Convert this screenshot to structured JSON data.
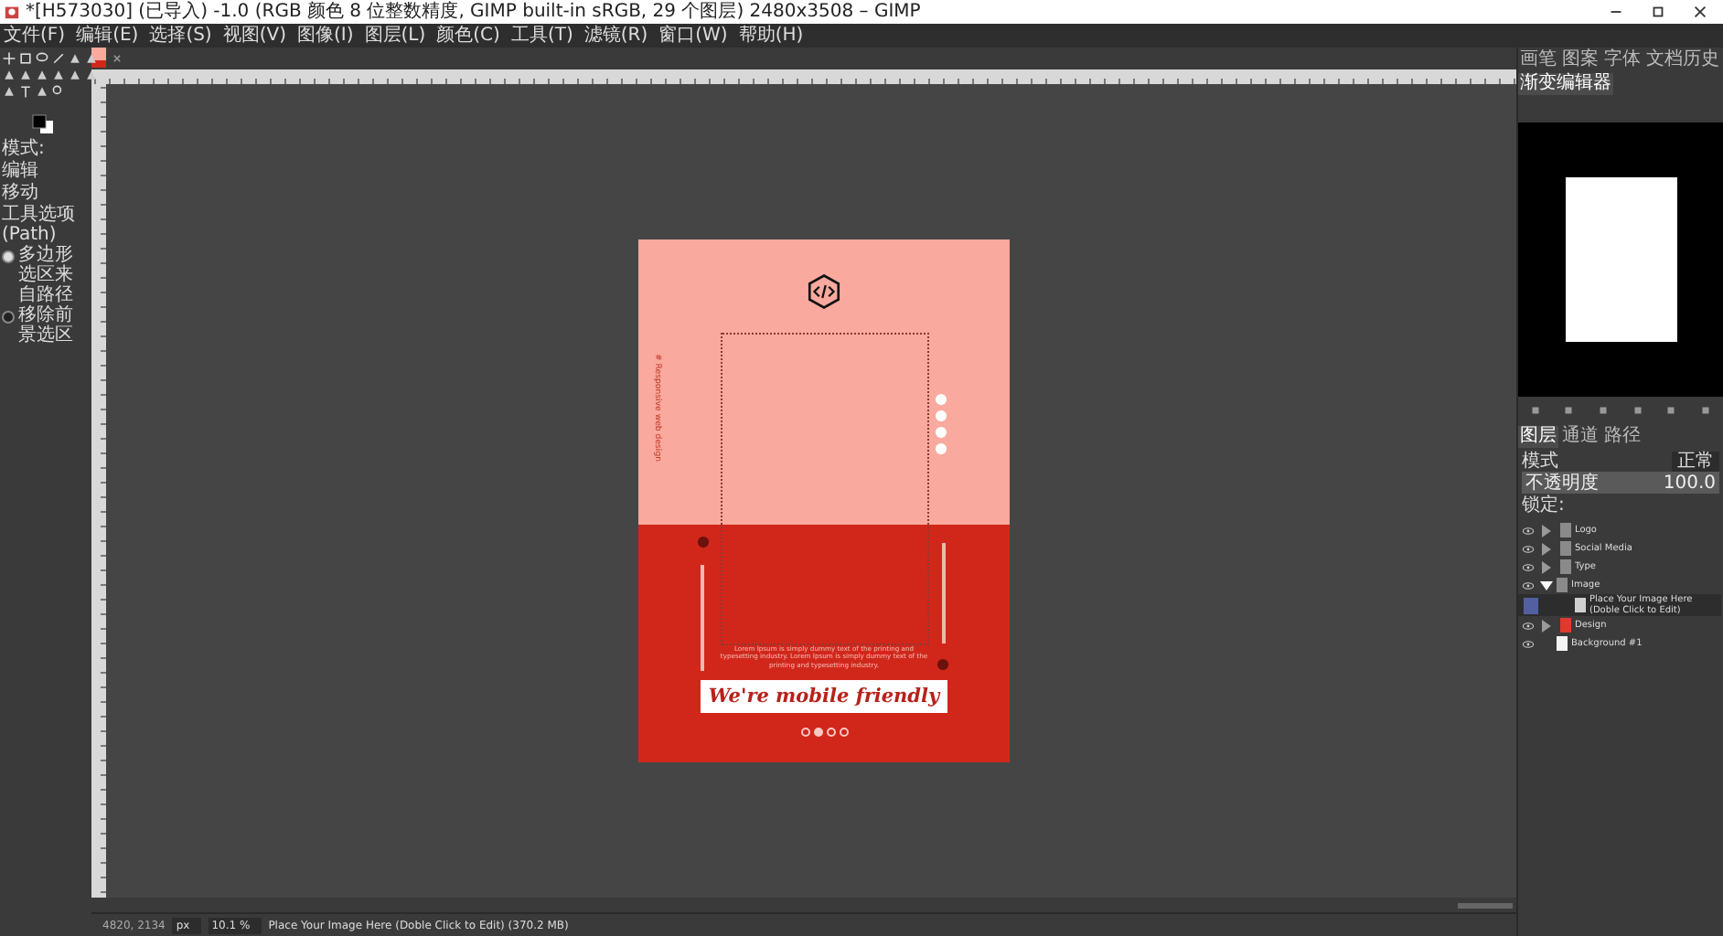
{
  "window": {
    "title": "*[H573030] (已导入) -1.0 (RGB 颜色 8 位整数精度, GIMP built-in sRGB, 29 个图层) 2480x3508 – GIMP"
  },
  "menu": [
    "文件(F)",
    "编辑(E)",
    "选择(S)",
    "视图(V)",
    "图像(I)",
    "图层(L)",
    "颜色(C)",
    "工具(T)",
    "滤镜(R)",
    "窗口(W)",
    "帮助(H)"
  ],
  "tool_options": {
    "mode_label": "模式:",
    "edit_label": "编辑",
    "move_label": "移动",
    "title": "工具选项 (Path)",
    "options": [
      {
        "label": "多边形选区来自路径",
        "checked": true
      },
      {
        "label": "移除前景选区",
        "checked": false
      }
    ]
  },
  "dock_tabs": [
    {
      "label": "画笔",
      "selected": false
    },
    {
      "label": "图案",
      "selected": false
    },
    {
      "label": "字体",
      "selected": false
    },
    {
      "label": "文档历史",
      "selected": false
    },
    {
      "label": "渐变编辑器",
      "selected": true
    }
  ],
  "layers_panel": {
    "tabs": [
      {
        "label": "图层",
        "selected": true
      },
      {
        "label": "通道",
        "selected": false
      },
      {
        "label": "路径",
        "selected": false
      }
    ],
    "mode_label": "模式",
    "mode_value": "正常",
    "opacity": {
      "label": "不透明度",
      "value": "100.0",
      "level": 1
    },
    "lock_label": "锁定:",
    "layers": [
      {
        "name": "Logo",
        "kind": "group",
        "visible": true,
        "expanded": false,
        "selected": false,
        "color": "#8a8a8a"
      },
      {
        "name": "Social Media",
        "kind": "group",
        "visible": true,
        "expanded": false,
        "selected": false,
        "color": "#8a8a8a"
      },
      {
        "name": "Type",
        "kind": "group",
        "visible": true,
        "expanded": false,
        "selected": false,
        "color": "#8a8a8a"
      },
      {
        "name": "Image",
        "kind": "group",
        "visible": true,
        "expanded": true,
        "selected": false,
        "color": "#8a8a8a",
        "children": [
          {
            "name": "Place Your Image Here (Doble Click to Edit)",
            "kind": "layer",
            "visible": false,
            "selected": true,
            "color": "#d0d0d0"
          }
        ]
      },
      {
        "name": "Design",
        "kind": "group",
        "visible": true,
        "expanded": false,
        "selected": false,
        "color": "#e03a2e"
      },
      {
        "name": "Background #1",
        "kind": "layer",
        "visible": true,
        "selected": false,
        "color": "#f4f4f4"
      }
    ]
  },
  "poster": {
    "vertical_text": "# Responsive web design",
    "body": "Lorem Ipsum is simply dummy text of the printing and typesetting industry. Lorem Ipsum is simply dummy text of the printing and typesetting industry.",
    "headline": "We're mobile friendly",
    "pages": [
      {
        "selected": false
      },
      {
        "selected": true
      },
      {
        "selected": false
      },
      {
        "selected": false
      }
    ]
  },
  "status_bar": {
    "coords": "4820, 2134",
    "unit": "px",
    "zoom": "10.1 %",
    "message": "Place Your Image Here (Doble Click to Edit) (370.2 MB)"
  }
}
